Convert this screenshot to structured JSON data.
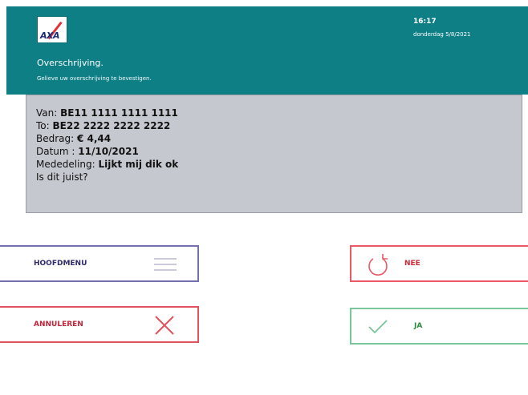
{
  "header": {
    "logo_text": "AXA",
    "title": "Overschrijving.",
    "subtitle": "Gelieve uw overschrijving te bevestigen.",
    "time": "16:17",
    "date": "donderdag 5/8/2021",
    "bg_color": "#0f7f86"
  },
  "details": {
    "van_label": "Van: ",
    "van_value": "BE11 1111 1111 1111",
    "to_label": "To: ",
    "to_value": "BE22 2222 2222 2222",
    "bedrag_label": "Bedrag: ",
    "bedrag_value": "€ 4,44",
    "datum_label": "Datum : ",
    "datum_value": "11/10/2021",
    "mededeling_label": "Mededeling: ",
    "mededeling_value": "Lijkt mij dik ok",
    "question": "Is dit juist?"
  },
  "buttons": {
    "menu_label": "HOOFDMENU",
    "menu_icon": "hamburger-icon",
    "cancel_label": "ANNULEREN",
    "cancel_icon": "close-x-icon",
    "nee_label": "NEE",
    "nee_icon": "undo-arrow-icon",
    "ja_label": "JA",
    "ja_icon": "checkmark-icon"
  }
}
